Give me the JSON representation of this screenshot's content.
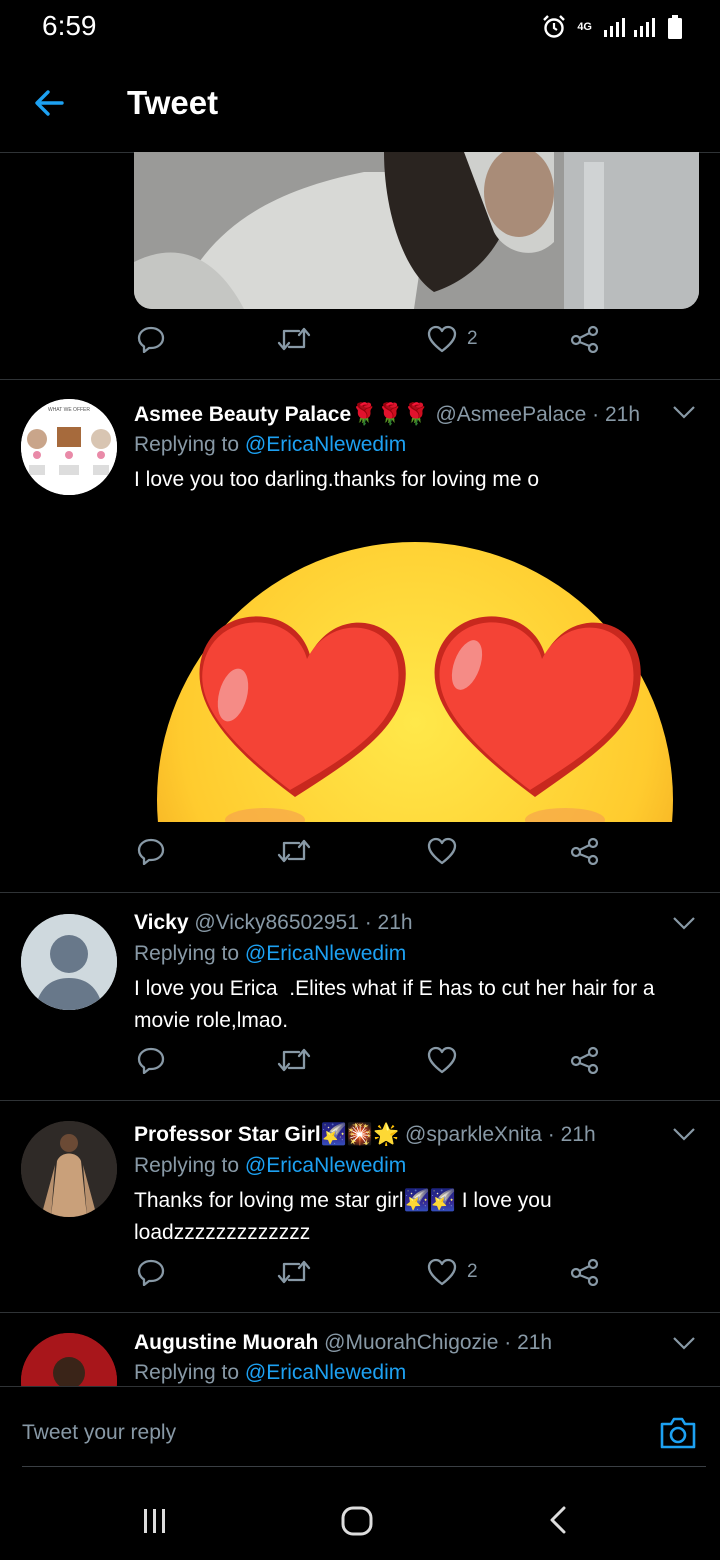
{
  "status_bar": {
    "time": "6:59",
    "network": "4G",
    "icons": [
      "alarm-icon",
      "signal-icon",
      "battery-icon"
    ]
  },
  "header": {
    "back_icon": "arrow-left-icon",
    "title": "Tweet"
  },
  "colors": {
    "background": "#000000",
    "accent": "#1da1f2",
    "secondary_text": "#8899a6",
    "divider": "#2f3336"
  },
  "main_tweet": {
    "actions": {
      "reply": "",
      "retweet": "",
      "like_count": "2",
      "share": ""
    }
  },
  "replies": [
    {
      "name": "Asmee Beauty Palace",
      "name_emoji": "🌹🌹🌹",
      "handle": "@AsmeePalace",
      "time": "· 21h",
      "replying_label": "Replying to",
      "replying_to": "@EricaNlewedim",
      "text": "I love you too darling.thanks for loving me o",
      "avatar_text": "WHAT WE OFFER",
      "like_count": ""
    },
    {
      "name": "Vicky",
      "handle": "@Vicky86502951",
      "time": "· 21h",
      "replying_label": "Replying to",
      "replying_to": "@EricaNlewedim",
      "text": "I love you Erica  .Elites what if E has to cut her hair for a movie role,lmao.",
      "like_count": ""
    },
    {
      "name": "Professor Star Girl",
      "name_emoji": "🌠🎇🌟",
      "handle": "@sparkleXnita",
      "time": "· 21h",
      "replying_label": "Replying to",
      "replying_to": "@EricaNlewedim",
      "text_a": "Thanks for loving me star girl",
      "text_emoji": "🌠🌠",
      "text_b": " I love you loadzzzzzzzzzzzzz",
      "like_count": "2"
    },
    {
      "name": "Augustine Muorah",
      "handle": "@MuorahChigozie",
      "time": "· 21h",
      "replying_label": "Replying to",
      "replying_to": "@EricaNlewedim"
    }
  ],
  "reply_box": {
    "placeholder": "Tweet your reply",
    "camera_icon": "camera-icon"
  },
  "nav_bar": {
    "icons": [
      "recent-apps-icon",
      "home-icon",
      "back-icon"
    ]
  }
}
